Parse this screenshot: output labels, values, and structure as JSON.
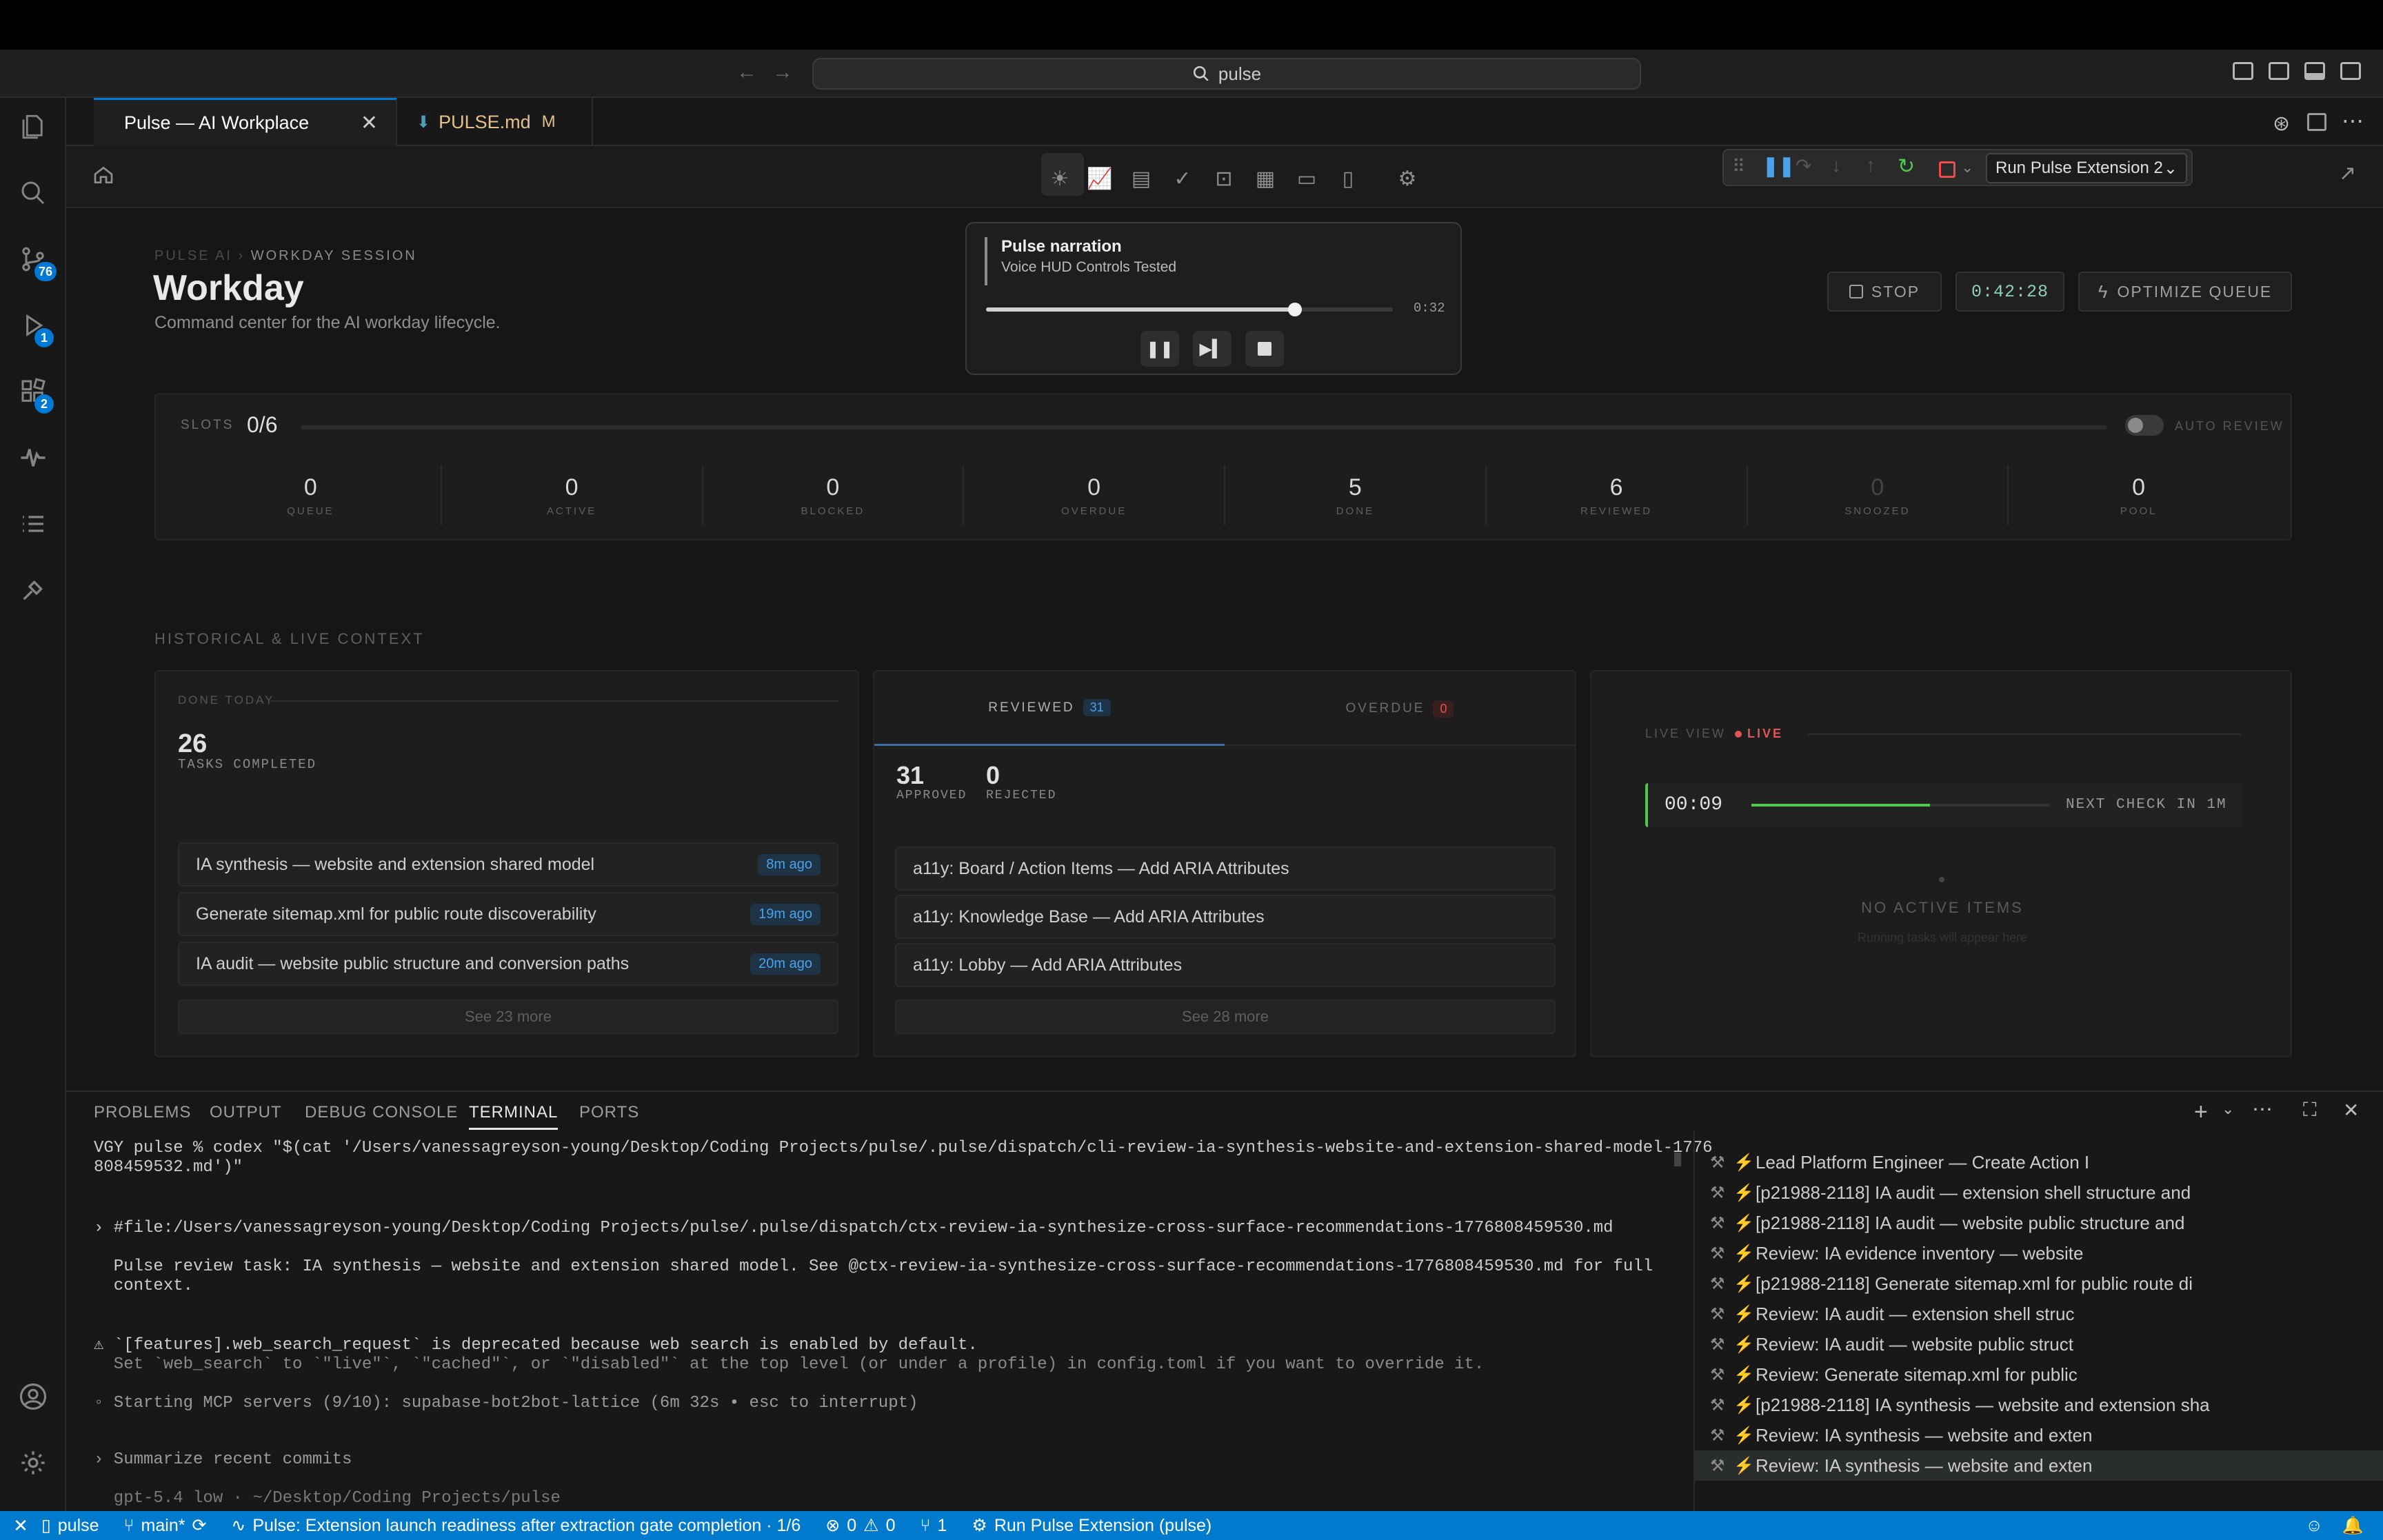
{
  "titlebar": {
    "search_text": "pulse"
  },
  "activity": {
    "source_control_badge": "76",
    "run_debug_badge": "1",
    "extensions_badge": "2"
  },
  "tabs": [
    {
      "label": "Pulse — AI Workplace"
    },
    {
      "label": "PULSE.md",
      "modified": "M"
    }
  ],
  "debug_toolbar": {
    "config": "Run Pulse Extension 2"
  },
  "header": {
    "breadcrumb_root": "PULSE AI",
    "breadcrumb_sep": "›",
    "breadcrumb_leaf": "WORKDAY SESSION",
    "title": "Workday",
    "subtitle": "Command center for the AI workday lifecycle."
  },
  "narration": {
    "title": "Pulse narration",
    "track": "Voice HUD Controls Tested",
    "time": "0:32",
    "progress": 0.76
  },
  "controls": {
    "stop_label": "STOP",
    "timer": "0:42:28",
    "optimize_label": "OPTIMIZE QUEUE"
  },
  "slots": {
    "label": "SLOTS",
    "value": "0/6",
    "auto_review_label": "AUTO REVIEW",
    "stats": [
      {
        "value": "0",
        "label": "QUEUE"
      },
      {
        "value": "0",
        "label": "ACTIVE"
      },
      {
        "value": "0",
        "label": "BLOCKED"
      },
      {
        "value": "0",
        "label": "OVERDUE"
      },
      {
        "value": "5",
        "label": "DONE"
      },
      {
        "value": "6",
        "label": "REVIEWED"
      },
      {
        "value": "0",
        "label": "SNOOZED"
      },
      {
        "value": "0",
        "label": "POOL"
      }
    ]
  },
  "context": {
    "heading": "HISTORICAL & LIVE CONTEXT",
    "done_today": {
      "label": "DONE TODAY",
      "count": "26",
      "count_label": "TASKS COMPLETED",
      "items": [
        {
          "title": "IA synthesis — website and extension shared model",
          "ago": "8m ago"
        },
        {
          "title": "Generate sitemap.xml for public route discoverability",
          "ago": "19m ago"
        },
        {
          "title": "IA audit — website public structure and conversion paths",
          "ago": "20m ago"
        }
      ],
      "more": "See 23 more"
    },
    "review": {
      "tab_reviewed": "REVIEWED",
      "reviewed_count": "31",
      "tab_overdue": "OVERDUE",
      "overdue_count": "0",
      "approved": "31",
      "approved_label": "APPROVED",
      "rejected": "0",
      "rejected_label": "REJECTED",
      "items": [
        "a11y: Board / Action Items — Add ARIA Attributes",
        "a11y: Knowledge Base — Add ARIA Attributes",
        "a11y: Lobby — Add ARIA Attributes"
      ],
      "more": "See 28 more"
    },
    "live": {
      "label": "LIVE VIEW",
      "live": "LIVE",
      "elapsed": "00:09",
      "progress": 0.6,
      "next_check": "NEXT CHECK IN 1M",
      "empty_title": "NO ACTIVE ITEMS",
      "empty_sub": "Running tasks will appear here"
    }
  },
  "panel": {
    "tabs": [
      "PROBLEMS",
      "OUTPUT",
      "DEBUG CONSOLE",
      "TERMINAL",
      "PORTS"
    ],
    "active_tab": "TERMINAL",
    "terminal_lines": [
      "VGY pulse % codex \"$(cat '/Users/vanessagreyson-young/Desktop/Coding Projects/pulse/.pulse/dispatch/cli-review-ia-synthesis-website-and-extension-shared-model-1776",
      "808459532.md')\"",
      "› #file:/Users/vanessagreyson-young/Desktop/Coding Projects/pulse/.pulse/dispatch/ctx-review-ia-synthesize-cross-surface-recommendations-1776808459530.md",
      "  Pulse review task: IA synthesis — website and extension shared model. See @ctx-review-ia-synthesize-cross-surface-recommendations-1776808459530.md for full",
      "  context.",
      "⚠ `[features].web_search_request` is deprecated because web search is enabled by default.",
      "  Set `web_search` to `\"live\"`, `\"cached\"`, or `\"disabled\"` at the top level (or under a profile) in config.toml if you want to override it.",
      "◦ Starting MCP servers (9/10): supabase-bot2bot-lattice (6m 32s • esc to interrupt)",
      "› Summarize recent commits",
      "  gpt-5.4 low · ~/Desktop/Coding Projects/pulse"
    ],
    "task_list": [
      "Lead Platform Engineer — Create Action I",
      "[p21988-2118] IA audit — extension shell structure and",
      "[p21988-2118] IA audit — website public structure and",
      "Review: IA evidence inventory — website",
      "[p21988-2118] Generate sitemap.xml for public route di",
      "Review: IA audit — extension shell struc",
      "Review: IA audit — website public struct",
      "Review: Generate sitemap.xml for public",
      "[p21988-2118] IA synthesis — website and extension sha",
      "Review: IA synthesis — website and exten",
      "Review: IA synthesis — website and exten"
    ]
  },
  "statusbar": {
    "workspace": "pulse",
    "branch": "main*",
    "task": "Pulse: Extension launch readiness after extraction gate completion · 1/6",
    "errors": "0",
    "warnings": "0",
    "ports": "1",
    "run": "Run Pulse Extension (pulse)"
  }
}
